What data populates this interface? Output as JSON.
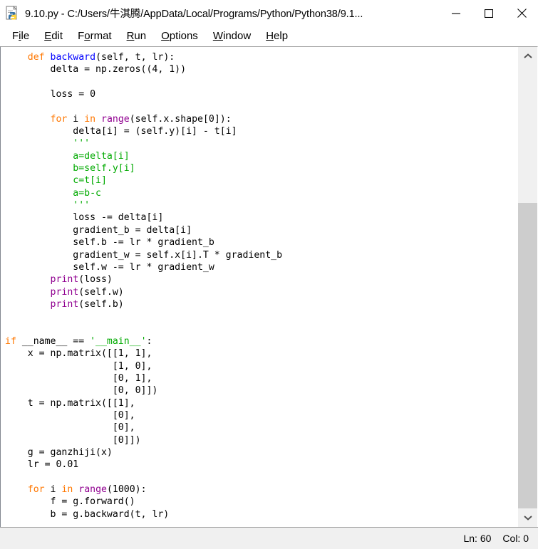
{
  "window": {
    "title": "9.10.py - C:/Users/牛淇腾/AppData/Local/Programs/Python/Python38/9.1...",
    "app_icon": "python-file-icon",
    "controls": {
      "minimize": "—",
      "maximize": "□",
      "close": "✕"
    }
  },
  "menubar": {
    "items": [
      {
        "label": "File",
        "pre": "F",
        "mnemonic": "i",
        "post": "le"
      },
      {
        "label": "Edit",
        "pre": "",
        "mnemonic": "E",
        "post": "dit"
      },
      {
        "label": "Format",
        "pre": "F",
        "mnemonic": "o",
        "post": "rmat"
      },
      {
        "label": "Run",
        "pre": "",
        "mnemonic": "R",
        "post": "un"
      },
      {
        "label": "Options",
        "pre": "",
        "mnemonic": "O",
        "post": "ptions"
      },
      {
        "label": "Window",
        "pre": "",
        "mnemonic": "W",
        "post": "indow"
      },
      {
        "label": "Help",
        "pre": "",
        "mnemonic": "H",
        "post": "elp"
      }
    ]
  },
  "editor": {
    "language": "python",
    "colors": {
      "keyword": "#ff7700",
      "definition": "#0000ff",
      "builtin": "#900090",
      "string": "#00aa00",
      "plain": "#000000",
      "background": "#ffffff"
    },
    "code_lines": [
      "    def backward(self, t, lr):",
      "        delta = np.zeros((4, 1))",
      "",
      "        loss = 0",
      "",
      "        for i in range(self.x.shape[0]):",
      "            delta[i] = (self.y)[i] - t[i]",
      "            '''",
      "            a=delta[i]",
      "            b=self.y[i]",
      "            c=t[i]",
      "            a=b-c",
      "            '''",
      "            loss -= delta[i]",
      "            gradient_b = delta[i]",
      "            self.b -= lr * gradient_b",
      "            gradient_w = self.x[i].T * gradient_b",
      "            self.w -= lr * gradient_w",
      "        print(loss)",
      "        print(self.w)",
      "        print(self.b)",
      "",
      "",
      "if __name__ == '__main__':",
      "    x = np.matrix([[1, 1],",
      "                   [1, 0],",
      "                   [0, 1],",
      "                   [0, 0]])",
      "    t = np.matrix([[1],",
      "                   [0],",
      "                   [0],",
      "                   [0]])",
      "    g = ganzhiji(x)",
      "    lr = 0.01",
      "",
      "    for i in range(1000):",
      "        f = g.forward()",
      "        b = g.backward(t, lr)"
    ]
  },
  "scrollbar": {
    "up_arrow": "⌃",
    "down_arrow": "⌄",
    "thumb_top_percent": 31
  },
  "statusbar": {
    "line_label": "Ln: 60",
    "col_label": "Col: 0"
  }
}
